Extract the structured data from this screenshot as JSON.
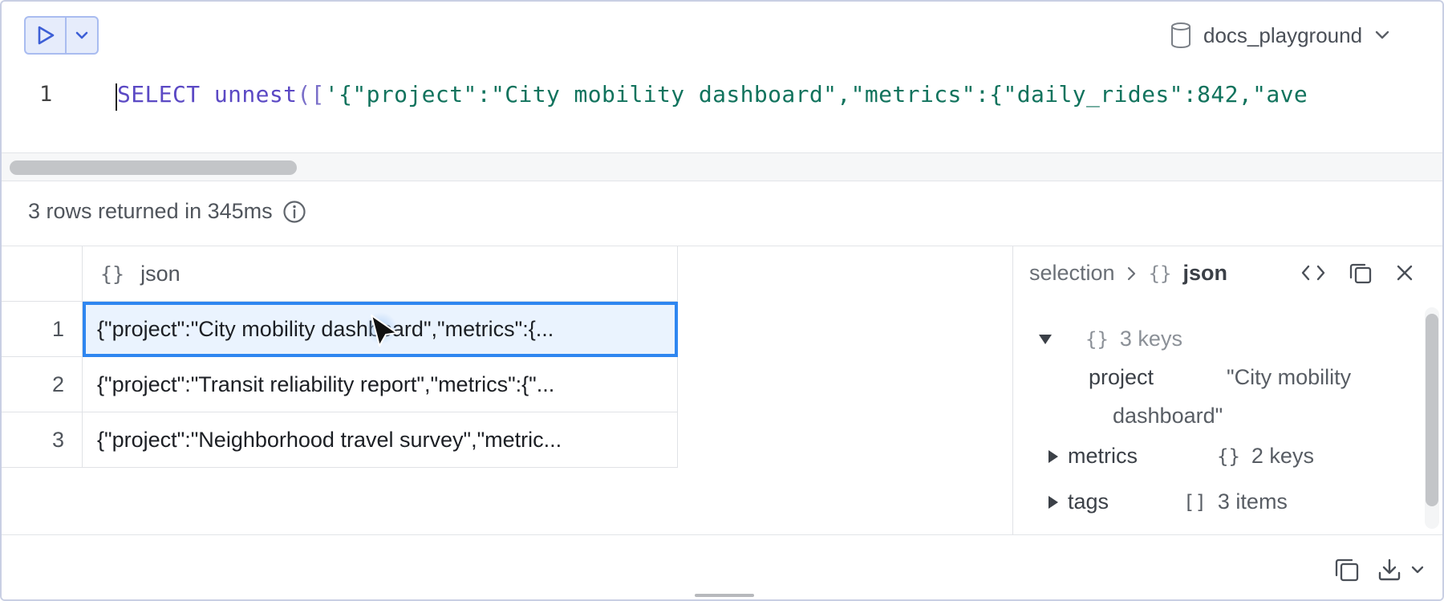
{
  "toolbar": {
    "run_icon": "play-icon",
    "run_options_icon": "chevron-down-icon",
    "database": "docs_playground",
    "database_icon": "database-icon"
  },
  "editor": {
    "line_number": "1",
    "tokens": {
      "kw": "SELECT",
      "fn": "unnest",
      "open": "([",
      "str": "'{\"project\":\"City mobility dashboard\",\"metrics\":{\"daily_rides\":842,\"ave"
    }
  },
  "status": {
    "text": "3 rows returned in 345ms",
    "info_icon": "info-icon"
  },
  "table": {
    "column": {
      "icon": "{}",
      "name": "json"
    },
    "rows": [
      {
        "num": "1",
        "value": "{\"project\":\"City mobility dashboard\",\"metrics\":{..."
      },
      {
        "num": "2",
        "value": "{\"project\":\"Transit reliability report\",\"metrics\":{\"..."
      },
      {
        "num": "3",
        "value": "{\"project\":\"Neighborhood travel survey\",\"metric..."
      }
    ]
  },
  "inspector": {
    "breadcrumb_root": "selection",
    "breadcrumb_icon": "{}",
    "breadcrumb_current": "json",
    "root_icon": "{}",
    "root_summary": "3 keys",
    "entries": [
      {
        "key": "project",
        "value_line1": "\"City mobility",
        "value_line2": "dashboard\""
      },
      {
        "key": "metrics",
        "icon": "{}",
        "summary": "2 keys"
      },
      {
        "key": "tags",
        "icon": "[]",
        "summary": "3 items"
      }
    ]
  },
  "colors": {
    "accent": "#2e86f0",
    "string": "#11735d",
    "keyword": "#5b49c4"
  }
}
